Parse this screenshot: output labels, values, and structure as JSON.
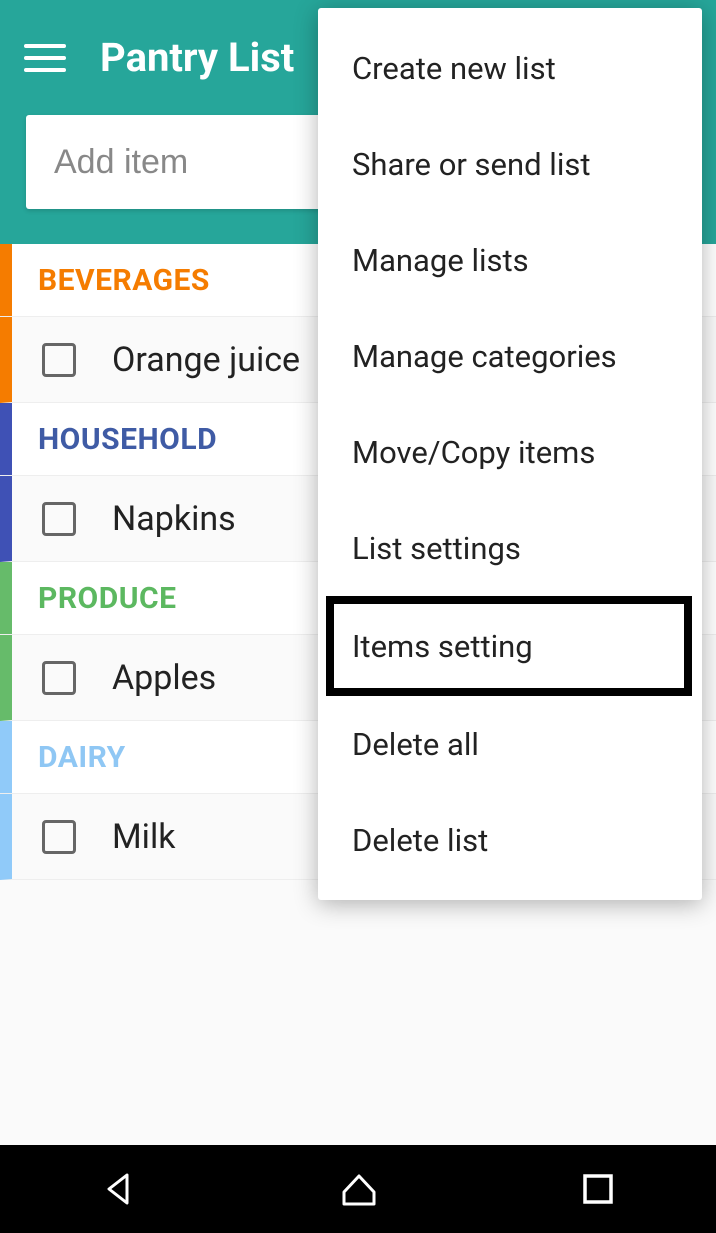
{
  "header": {
    "title": "Pantry List",
    "add_item_placeholder": "Add item"
  },
  "categories": [
    {
      "id": "beverages",
      "label": "BEVERAGES",
      "color": "#f57c00",
      "text_color": "#f57c00",
      "items": [
        {
          "name": "Orange juice",
          "checked": false
        }
      ]
    },
    {
      "id": "household",
      "label": "HOUSEHOLD",
      "color": "#3f51b5",
      "text_color": "#3f5ba5",
      "items": [
        {
          "name": "Napkins",
          "checked": false
        }
      ]
    },
    {
      "id": "produce",
      "label": "PRODUCE",
      "color": "#66bb6a",
      "text_color": "#5cb860",
      "items": [
        {
          "name": "Apples",
          "checked": false
        }
      ]
    },
    {
      "id": "dairy",
      "label": "DAIRY",
      "color": "#90caf9",
      "text_color": "#8fc7f4",
      "items": [
        {
          "name": "Milk",
          "checked": false
        }
      ]
    }
  ],
  "menu": {
    "items": [
      {
        "label": "Create new list",
        "highlighted": false
      },
      {
        "label": "Share or send list",
        "highlighted": false
      },
      {
        "label": "Manage lists",
        "highlighted": false
      },
      {
        "label": "Manage categories",
        "highlighted": false
      },
      {
        "label": "Move/Copy items",
        "highlighted": false
      },
      {
        "label": "List settings",
        "highlighted": false
      },
      {
        "label": "Items setting",
        "highlighted": true
      },
      {
        "label": "Delete all",
        "highlighted": false
      },
      {
        "label": "Delete list",
        "highlighted": false
      }
    ]
  }
}
